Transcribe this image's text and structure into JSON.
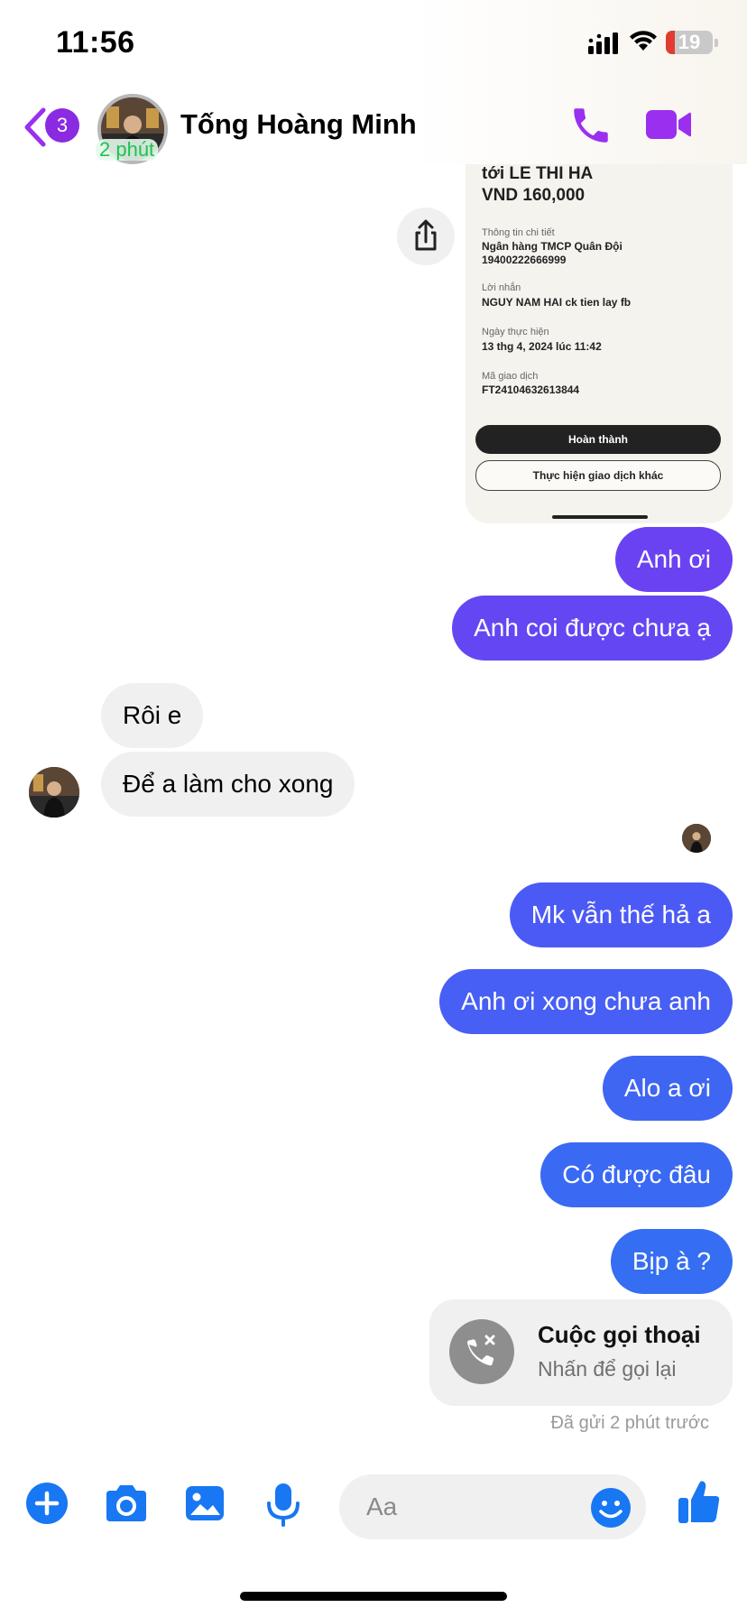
{
  "status_bar": {
    "time": "11:56",
    "battery": "19",
    "battery_level": 0.19
  },
  "header": {
    "unread_count": "3",
    "contact_name": "Tống Hoàng Minh",
    "active_label": "2 phút",
    "icons": {
      "back": "chevron-left-icon",
      "call": "phone-icon",
      "video": "video-camera-icon"
    },
    "accent_color": "#9b2ff0"
  },
  "attachment": {
    "recipient": "tới LE THI HA",
    "amount": "VND 160,000",
    "details_label": "Thông tin chi tiết",
    "bank": "Ngân hàng TMCP Quân Đội",
    "account": "19400222666999",
    "message_label": "Lời nhắn",
    "message": "NGUY NAM HAI ck tien lay fb",
    "date_label": "Ngày thực hiện",
    "date": "13 thg 4, 2024 lúc 11:42",
    "txn_label": "Mã giao dịch",
    "txn_id": "FT24104632613844",
    "done_button": "Hoàn thành",
    "other_button": "Thực hiện giao dịch khác"
  },
  "messages": [
    {
      "dir": "out",
      "text": "Anh ơi",
      "color": "#6a42f2"
    },
    {
      "dir": "out",
      "text": "Anh coi được chưa ạ",
      "color": "#6447f3"
    },
    {
      "dir": "in",
      "text": "Rôi e"
    },
    {
      "dir": "in",
      "text": "Để a làm cho xong"
    },
    {
      "dir": "out",
      "text": "Mk vẫn thế hả a",
      "color": "#4c5af5"
    },
    {
      "dir": "out",
      "text": "Anh ơi xong chưa anh",
      "color": "#475ff4"
    },
    {
      "dir": "out",
      "text": "Alo a ơi",
      "color": "#3f65f3"
    },
    {
      "dir": "out",
      "text": "Có được đâu",
      "color": "#3a69f3"
    },
    {
      "dir": "out",
      "text": "Bịp à ?",
      "color": "#356ef2"
    }
  ],
  "call_card": {
    "title": "Cuộc gọi thoại",
    "subtitle": "Nhấn để gọi lại"
  },
  "sent_status": "Đã gửi 2 phút trước",
  "composer": {
    "placeholder": "Aa",
    "icons": [
      "plus-icon",
      "camera-icon",
      "image-icon",
      "microphone-icon",
      "emoji-icon",
      "thumbs-up-icon"
    ],
    "icon_color": "#1877f2"
  }
}
